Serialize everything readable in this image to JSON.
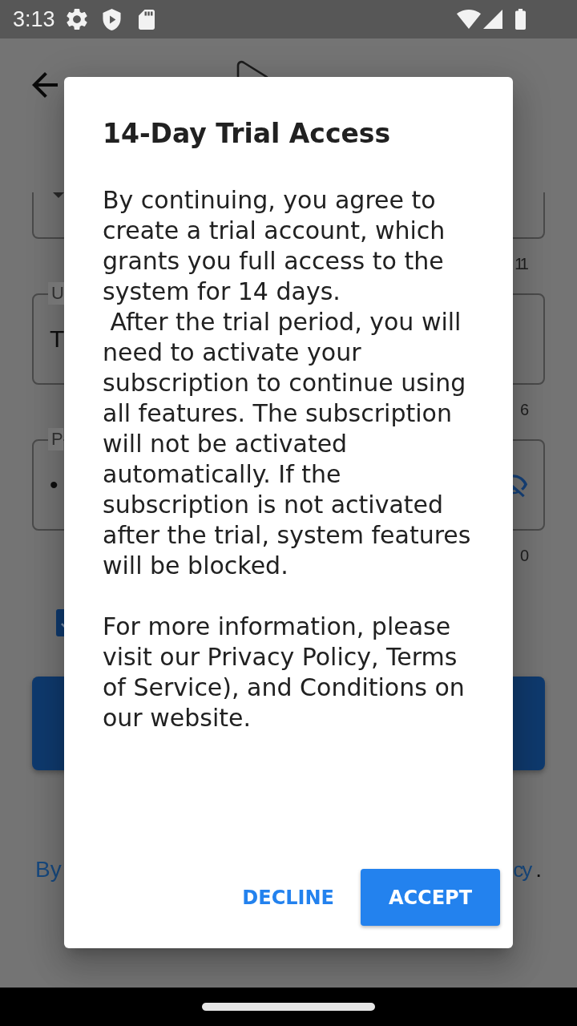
{
  "status_bar": {
    "time": "3:13"
  },
  "form": {
    "fields": [
      {
        "kind": "select",
        "counter": "11"
      },
      {
        "kind": "text",
        "label": "U",
        "value": "T",
        "counter": "6"
      },
      {
        "kind": "password",
        "label": "P",
        "value": "•",
        "counter": "0"
      }
    ],
    "checkbox": {
      "checked": true
    },
    "footer": {
      "start": "By",
      "link_end": "cy",
      "end": "."
    }
  },
  "dialog": {
    "title": "14-Day Trial Access",
    "body": "By continuing, you agree to create a trial account, which grants you full access to the system for 14 days.\n After the trial period, you will need to activate your subscription to continue using all features. The subscription will not be activated automatically. If the subscription is not activated after the trial, system features will be blocked.\n\nFor more information, please visit our Privacy Policy, Terms of Service), and Conditions on our website.",
    "buttons": [
      {
        "kind": "text",
        "label": "DECLINE"
      },
      {
        "kind": "contained",
        "label": "ACCEPT"
      }
    ]
  }
}
